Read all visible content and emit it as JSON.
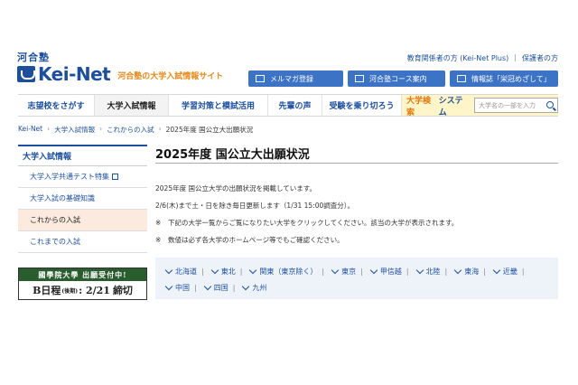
{
  "header": {
    "brand_small": "河合塾",
    "brand_main": "Kei-Net",
    "tagline": "河合塾の大学入試情報サイト",
    "top_links": [
      "教育関係者の方 (Kei-Net Plus)",
      "保護者の方"
    ],
    "buttons": {
      "mail": "メルマガ登録",
      "course": "河合塾コース案内",
      "magazine": "情報誌「栄冠めざして」"
    }
  },
  "nav": {
    "items": [
      "志望校をさがす",
      "大学入試情報",
      "学習対策と模試活用",
      "先輩の声",
      "受験を乗り切ろう"
    ],
    "system_part1": "大学検索",
    "system_part2": "システム",
    "search_placeholder": "大学名の一部を入力"
  },
  "breadcrumb": [
    "Kei-Net",
    "大学入試情報",
    "これからの入試",
    "2025年度 国公立大出願状況"
  ],
  "sidebar": {
    "heading": "大学入試情報",
    "items": [
      "大学入学共通テスト特集",
      "大学入試の基礎知識",
      "これからの入試",
      "これまでの入試"
    ]
  },
  "banner": {
    "top": "國學院大學 出願受付中!",
    "part1": "B日程",
    "part2": "(後期)",
    "part3": ": 2/21",
    "part4": "締切"
  },
  "main": {
    "title": "2025年度 国公立大出願状況",
    "p1": "2025年度 国公立大学の出願状況を掲載しています。",
    "p2": "2/6(木)まで土・日を除き毎日更新します（1/31 15:00調査分）。",
    "note_mark": "※",
    "note1": "下記の大学一覧からご覧になりたい大学をクリックしてください。該当の大学が表示されます。",
    "note2": "数値は必ず各大学のホームページ等でもご確認ください。",
    "regions_row1": [
      "北海道",
      "東北",
      "関東（東京除く）",
      "東京",
      "甲信越",
      "北陸",
      "東海",
      "近畿"
    ],
    "regions_row2": [
      "中国",
      "四国",
      "九州"
    ]
  }
}
